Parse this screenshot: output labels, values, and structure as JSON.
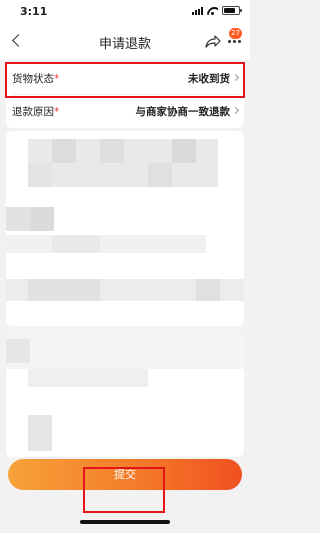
{
  "status_bar": {
    "time": "3:11",
    "signal_icon": "signal-icon",
    "wifi_icon": "wifi-icon",
    "battery_icon": "battery-icon"
  },
  "nav": {
    "title": "申请退款",
    "back_icon": "chevron-left-icon",
    "share_icon": "share-icon",
    "more_icon": "more-icon",
    "notification_count": "27"
  },
  "form": {
    "rows": [
      {
        "label": "货物状态",
        "required_mark": "*",
        "value": "未收到货"
      },
      {
        "label": "退款原因",
        "required_mark": "*",
        "value": "与商家协商一致退款"
      }
    ]
  },
  "submit_label": "提交",
  "colors": {
    "accent_start": "#f7a23a",
    "accent_end": "#f0501f",
    "highlight_box": "#e4141b",
    "badge": "#ff5a1f"
  }
}
